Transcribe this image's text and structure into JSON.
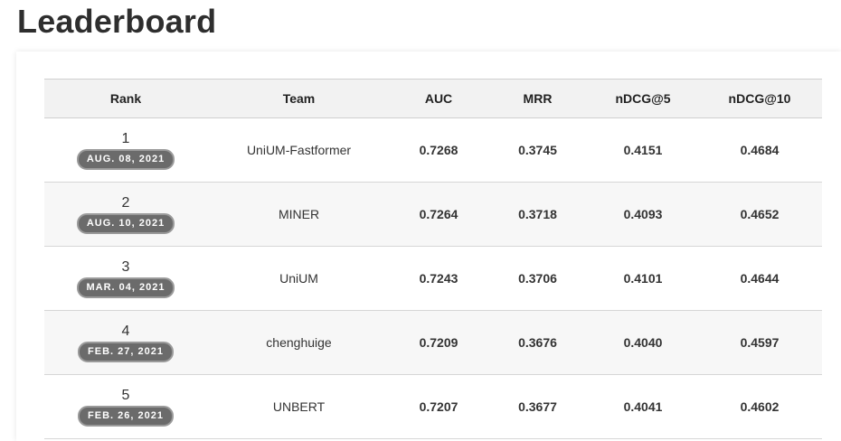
{
  "page": {
    "title": "Leaderboard"
  },
  "table": {
    "headers": [
      "Rank",
      "Team",
      "AUC",
      "MRR",
      "nDCG@5",
      "nDCG@10"
    ],
    "rows": [
      {
        "rank": "1",
        "date": "AUG. 08, 2021",
        "team": "UniUM-Fastformer",
        "auc": "0.7268",
        "mrr": "0.3745",
        "ndcg5": "0.4151",
        "ndcg10": "0.4684"
      },
      {
        "rank": "2",
        "date": "AUG. 10, 2021",
        "team": "MINER",
        "auc": "0.7264",
        "mrr": "0.3718",
        "ndcg5": "0.4093",
        "ndcg10": "0.4652"
      },
      {
        "rank": "3",
        "date": "MAR. 04, 2021",
        "team": "UniUM",
        "auc": "0.7243",
        "mrr": "0.3706",
        "ndcg5": "0.4101",
        "ndcg10": "0.4644"
      },
      {
        "rank": "4",
        "date": "FEB. 27, 2021",
        "team": "chenghuige",
        "auc": "0.7209",
        "mrr": "0.3676",
        "ndcg5": "0.4040",
        "ndcg10": "0.4597"
      },
      {
        "rank": "5",
        "date": "FEB. 26, 2021",
        "team": "UNBERT",
        "auc": "0.7207",
        "mrr": "0.3677",
        "ndcg5": "0.4041",
        "ndcg10": "0.4602"
      }
    ]
  },
  "colors": {
    "header_bg": "#f2f2f2",
    "alt_row_bg": "#f7f7f7",
    "badge_bg": "#6b6b6b",
    "badge_text": "#ffffff",
    "title_text": "#2e2e2e"
  }
}
